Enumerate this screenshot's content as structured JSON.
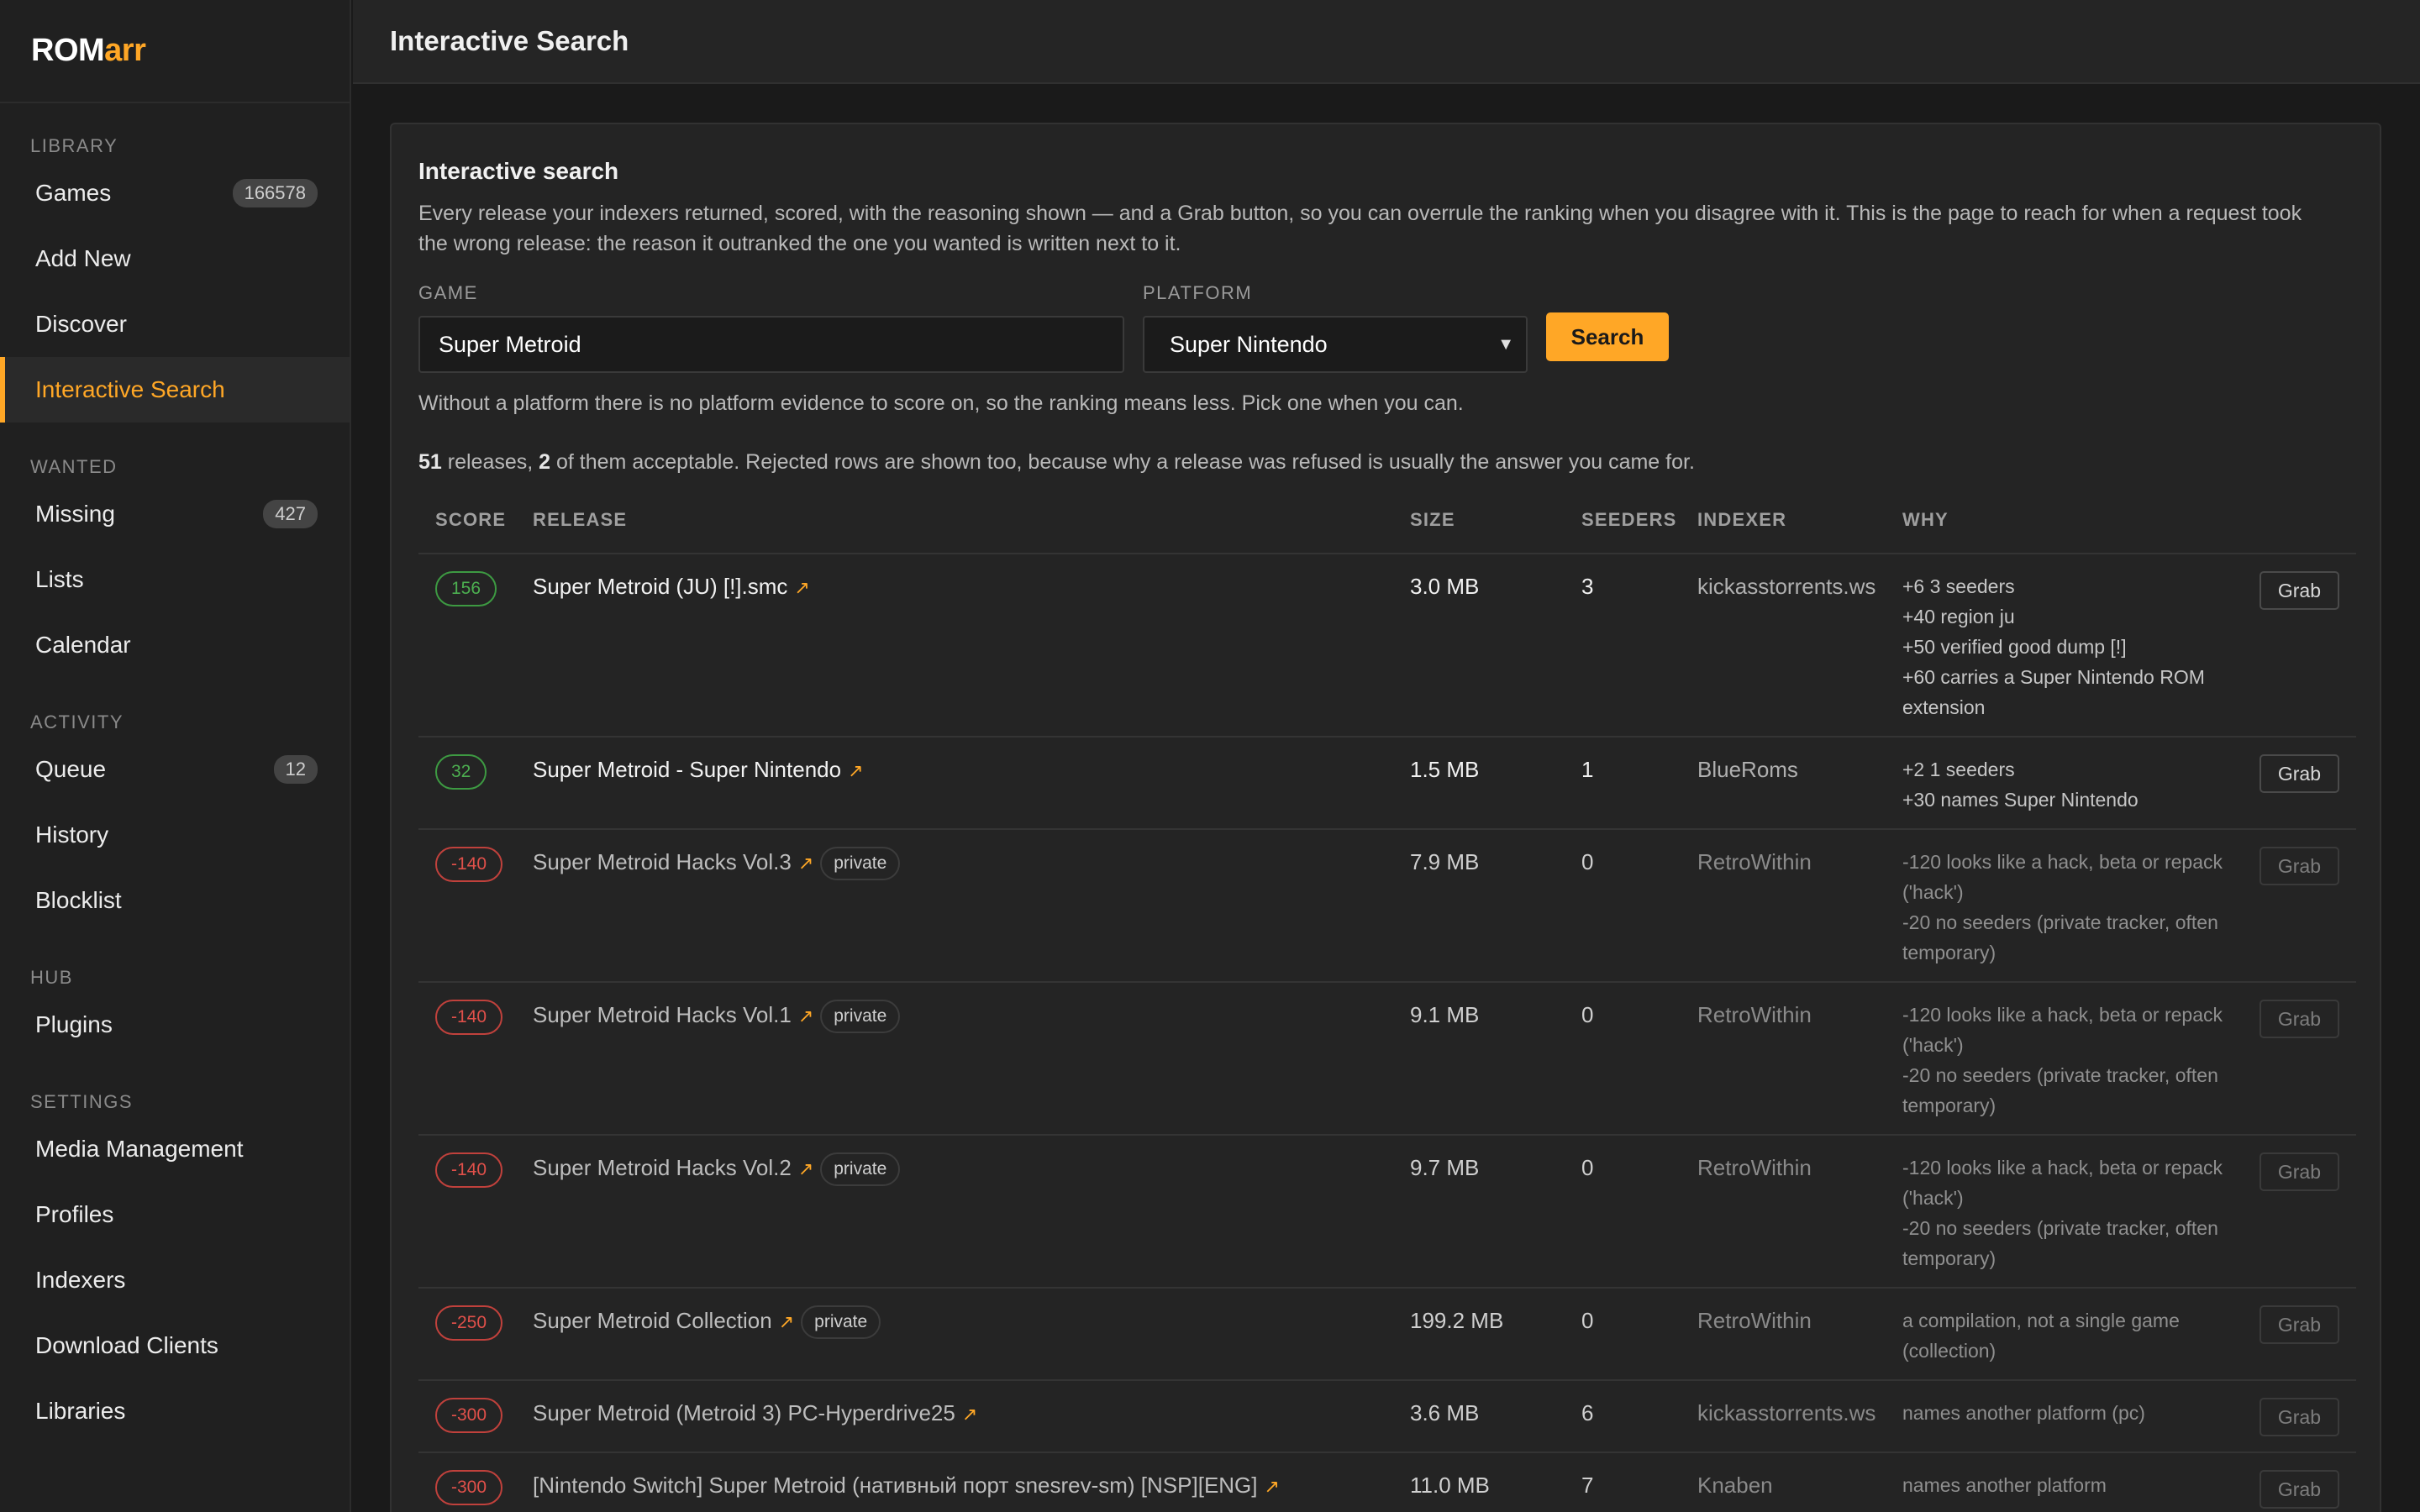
{
  "app": {
    "logo_part1": "ROM",
    "logo_part2": "arr"
  },
  "sidebar": {
    "sections": [
      {
        "title": "Library",
        "items": [
          {
            "label": "Games",
            "badge": "166578"
          },
          {
            "label": "Add New"
          },
          {
            "label": "Discover"
          },
          {
            "label": "Interactive Search",
            "active": true
          }
        ]
      },
      {
        "title": "Wanted",
        "items": [
          {
            "label": "Missing",
            "badge": "427"
          },
          {
            "label": "Lists"
          },
          {
            "label": "Calendar"
          }
        ]
      },
      {
        "title": "Activity",
        "items": [
          {
            "label": "Queue",
            "badge": "12"
          },
          {
            "label": "History"
          },
          {
            "label": "Blocklist"
          }
        ]
      },
      {
        "title": "Hub",
        "items": [
          {
            "label": "Plugins"
          }
        ]
      },
      {
        "title": "Settings",
        "items": [
          {
            "label": "Media Management"
          },
          {
            "label": "Profiles"
          },
          {
            "label": "Indexers"
          },
          {
            "label": "Download Clients"
          },
          {
            "label": "Libraries"
          }
        ]
      }
    ]
  },
  "header": {
    "title": "Interactive Search"
  },
  "search": {
    "card_title": "Interactive search",
    "description": "Every release your indexers returned, scored, with the reasoning shown — and a Grab button, so you can overrule the ranking when you disagree with it. This is the page to reach for when a request took the wrong release: the reason it outranked the one you wanted is written next to it.",
    "game_label": "Game",
    "game_value": "Super Metroid",
    "platform_label": "Platform",
    "platform_value": "Super Nintendo",
    "search_button": "Search",
    "hint": "Without a platform there is no platform evidence to score on, so the ranking means less. Pick one when you can.",
    "summary_count": "51",
    "summary_text_1": " releases, ",
    "summary_acceptable": "2",
    "summary_text_2": " of them acceptable. Rejected rows are shown too, because why a release was refused is usually the answer you came for."
  },
  "table": {
    "headers": {
      "score": "Score",
      "release": "Release",
      "size": "Size",
      "seeders": "Seeders",
      "indexer": "Indexer",
      "why": "Why"
    },
    "grab_label": "Grab",
    "private_label": "private",
    "rows": [
      {
        "score": "156",
        "accepted": true,
        "release": "Super Metroid (JU) [!].smc",
        "private": false,
        "size": "3.0 MB",
        "seeders": "3",
        "indexer": "kickasstorrents.ws",
        "why": "+6 3 seeders\n+40 region ju\n+50 verified good dump [!]\n+60 carries a Super Nintendo ROM extension"
      },
      {
        "score": "32",
        "accepted": true,
        "release": "Super Metroid - Super Nintendo",
        "private": false,
        "size": "1.5 MB",
        "seeders": "1",
        "indexer": "BlueRoms",
        "why": "+2 1 seeders\n+30 names Super Nintendo"
      },
      {
        "score": "-140",
        "accepted": false,
        "release": "Super Metroid Hacks Vol.3",
        "private": true,
        "size": "7.9 MB",
        "seeders": "0",
        "indexer": "RetroWithin",
        "why": "-120 looks like a hack, beta or repack ('hack')\n-20 no seeders (private tracker, often temporary)"
      },
      {
        "score": "-140",
        "accepted": false,
        "release": "Super Metroid Hacks Vol.1",
        "private": true,
        "size": "9.1 MB",
        "seeders": "0",
        "indexer": "RetroWithin",
        "why": "-120 looks like a hack, beta or repack ('hack')\n-20 no seeders (private tracker, often temporary)"
      },
      {
        "score": "-140",
        "accepted": false,
        "release": "Super Metroid Hacks Vol.2",
        "private": true,
        "size": "9.7 MB",
        "seeders": "0",
        "indexer": "RetroWithin",
        "why": "-120 looks like a hack, beta or repack ('hack')\n-20 no seeders (private tracker, often temporary)"
      },
      {
        "score": "-250",
        "accepted": false,
        "release": "Super Metroid Collection",
        "private": true,
        "size": "199.2 MB",
        "seeders": "0",
        "indexer": "RetroWithin",
        "why": "a compilation, not a single game (collection)"
      },
      {
        "score": "-300",
        "accepted": false,
        "release": "Super Metroid (Metroid 3) PC-Hyperdrive25",
        "private": false,
        "size": "3.6 MB",
        "seeders": "6",
        "indexer": "kickasstorrents.ws",
        "why": "names another platform (pc)"
      },
      {
        "score": "-300",
        "accepted": false,
        "release": "[Nintendo Switch] Super Metroid (нативный порт snesrev-sm) [NSP][ENG]",
        "private": false,
        "size": "11.0 MB",
        "seeders": "7",
        "indexer": "Knaben",
        "why": "names another platform"
      }
    ]
  },
  "colors": {
    "accent": "#ffa726",
    "accepted": "#4caf50",
    "rejected": "#e0504a",
    "background": "#1a1a1a"
  },
  "icons": {
    "external_link": "external-link-icon",
    "dropdown": "chevron-down-icon"
  }
}
